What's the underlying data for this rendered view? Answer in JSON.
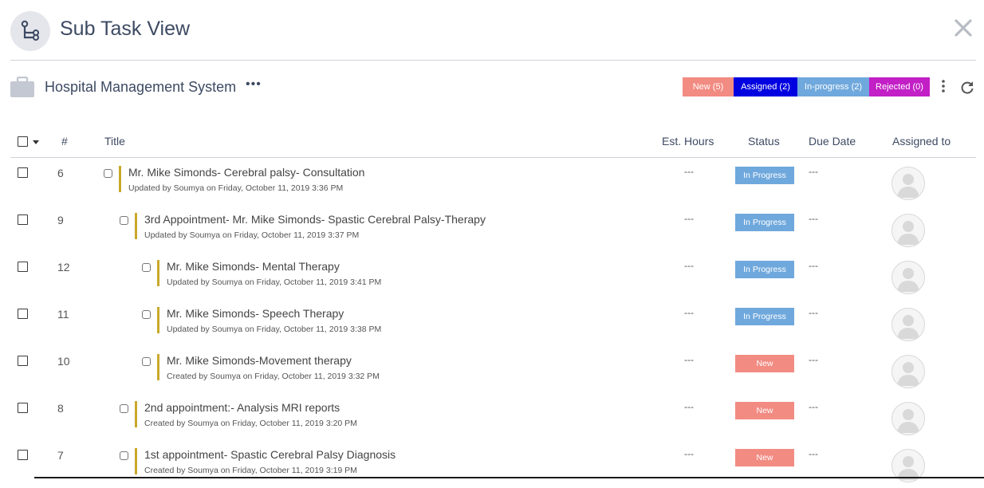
{
  "header": {
    "title": "Sub Task View",
    "icon": "subtask-icon",
    "close_icon": "close-icon"
  },
  "project": {
    "icon": "briefcase-icon",
    "name": "Hospital Management System",
    "more": "•••"
  },
  "badges": [
    {
      "label": "New (5)",
      "color": "#f28b82",
      "text_color": "#ffffff"
    },
    {
      "label": "Assigned (2)",
      "color": "#0000e0",
      "text_color": "#ffffff"
    },
    {
      "label": "In-progress (2)",
      "color": "#6fa8dc",
      "text_color": "#ffffff"
    },
    {
      "label": "Rejected (0)",
      "color": "#c21fc6",
      "text_color": "#ffffff"
    }
  ],
  "toolbar": {
    "menu_icon": "kebab-icon",
    "refresh_icon": "refresh-icon"
  },
  "columns": {
    "num": "#",
    "title": "Title",
    "hours": "Est. Hours",
    "status": "Status",
    "due": "Due Date",
    "assigned": "Assigned to"
  },
  "status_colors": {
    "In Progress": "#6fa8dc",
    "New": "#f28b82"
  },
  "rows": [
    {
      "num": "6",
      "level": 0,
      "title": "Mr. Mike Simonds- Cerebral palsy- Consultation",
      "sub": "Updated by Soumya on Friday, October 11, 2019 3:36 PM",
      "hours": "---",
      "status": "In Progress",
      "due": "---"
    },
    {
      "num": "9",
      "level": 1,
      "title": "3rd Appointment- Mr. Mike Simonds- Spastic Cerebral Palsy-Therapy",
      "sub": "Updated by Soumya on Friday, October 11, 2019 3:37 PM",
      "hours": "---",
      "status": "In Progress",
      "due": "---"
    },
    {
      "num": "12",
      "level": 2,
      "title": "Mr. Mike Simonds- Mental Therapy",
      "sub": "Updated by Soumya on Friday, October 11, 2019 3:41 PM",
      "hours": "---",
      "status": "In Progress",
      "due": "---"
    },
    {
      "num": "11",
      "level": 2,
      "title": "Mr. Mike Simonds- Speech Therapy",
      "sub": "Updated by Soumya on Friday, October 11, 2019 3:38 PM",
      "hours": "---",
      "status": "In Progress",
      "due": "---"
    },
    {
      "num": "10",
      "level": 2,
      "title": "Mr. Mike Simonds-Movement therapy",
      "sub": "Created by Soumya on Friday, October 11, 2019 3:32 PM",
      "hours": "---",
      "status": "New",
      "due": "---"
    },
    {
      "num": "8",
      "level": 1,
      "title": "2nd appointment:- Analysis MRI reports",
      "sub": "Created by Soumya on Friday, October 11, 2019 3:20 PM",
      "hours": "---",
      "status": "New",
      "due": "---"
    },
    {
      "num": "7",
      "level": 1,
      "title": "1st appointment- Spastic Cerebral Palsy Diagnosis",
      "sub": "Created by Soumya on Friday, October 11, 2019 3:19 PM",
      "hours": "---",
      "status": "New",
      "due": "---"
    }
  ]
}
